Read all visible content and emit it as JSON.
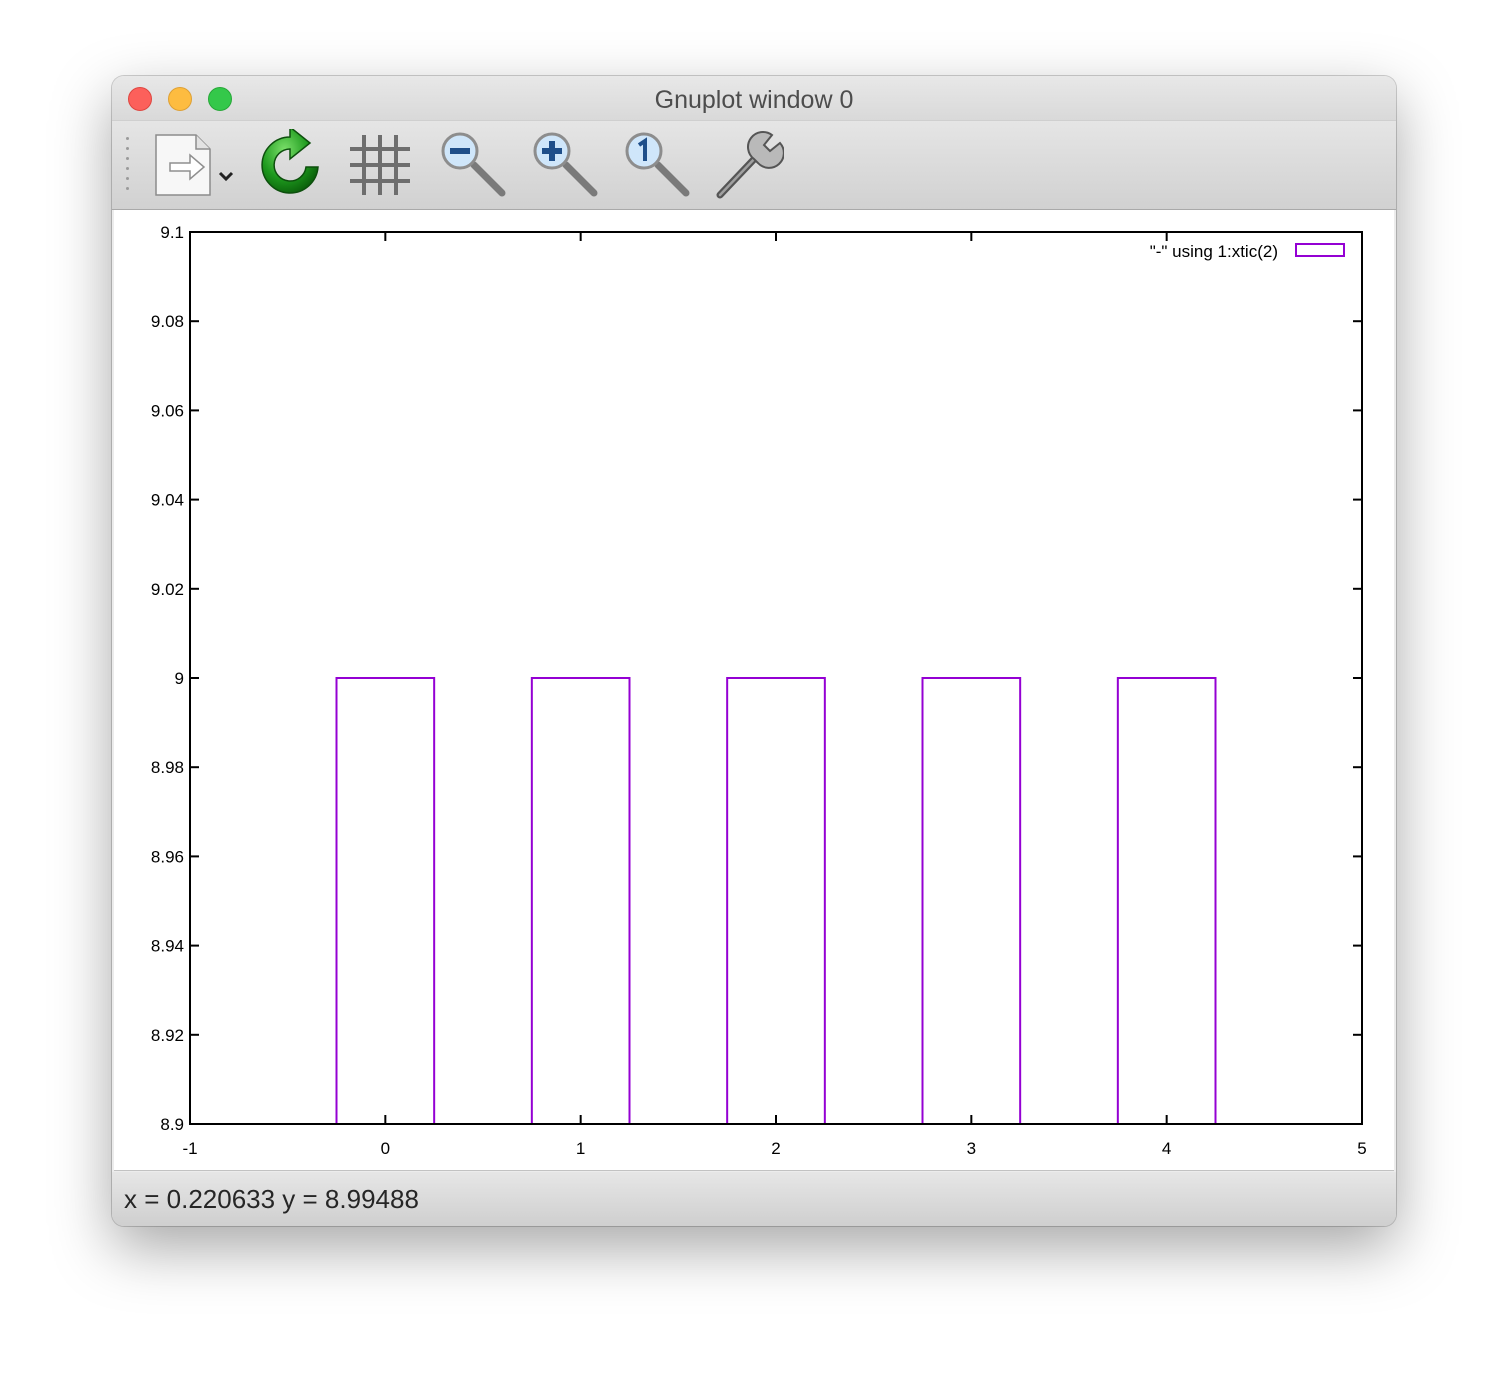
{
  "window": {
    "title": "Gnuplot window 0"
  },
  "toolbar": {
    "items": [
      {
        "name": "export-button",
        "icon": "export-document-icon"
      },
      {
        "name": "replot-button",
        "icon": "replot-icon"
      },
      {
        "name": "grid-button",
        "icon": "grid-icon"
      },
      {
        "name": "zoom-out-button",
        "icon": "zoom-out-icon"
      },
      {
        "name": "zoom-in-button",
        "icon": "zoom-in-icon"
      },
      {
        "name": "zoom-reset-button",
        "icon": "zoom-reset-icon"
      },
      {
        "name": "settings-button",
        "icon": "wrench-icon"
      }
    ]
  },
  "status": {
    "text": "x = 0.220633 y = 8.99488"
  },
  "chart_data": {
    "type": "bar",
    "title": "",
    "xlabel": "",
    "ylabel": "",
    "xlim": [
      -1,
      5
    ],
    "ylim": [
      8.9,
      9.1
    ],
    "xticks": [
      "-1",
      "0",
      "1",
      "2",
      "3",
      "4",
      "5"
    ],
    "yticks": [
      "8.9",
      "8.92",
      "8.94",
      "8.96",
      "8.98",
      "9",
      "9.02",
      "9.04",
      "9.06",
      "9.08",
      "9.1"
    ],
    "x": [
      0,
      1,
      2,
      3,
      4
    ],
    "values": [
      9,
      9,
      9,
      9,
      9
    ],
    "box_width": 0.5,
    "series": [
      {
        "name": "\"-\" using 1:xtic(2)",
        "values": [
          9,
          9,
          9,
          9,
          9
        ],
        "color": "#9400d3"
      }
    ],
    "legend": {
      "position": "top-right",
      "label": "\"-\" using 1:xtic(2)"
    },
    "grid": false,
    "mirror_ticks": true
  }
}
